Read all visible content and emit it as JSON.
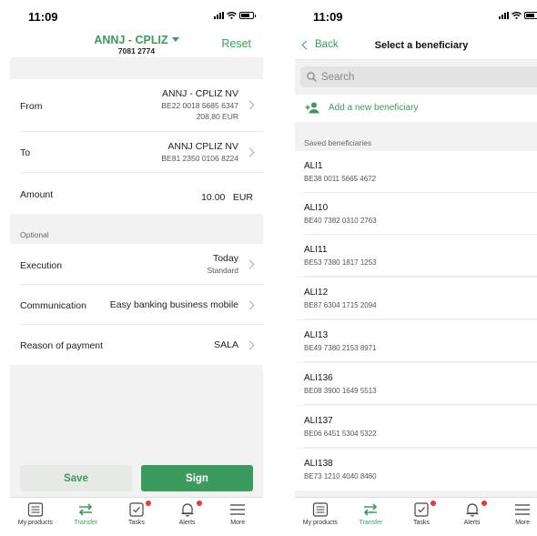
{
  "status": {
    "time": "11:09"
  },
  "transfer": {
    "account_title": "ANNJ - CPLIZ",
    "account_number": "7081 2774",
    "reset_label": "Reset",
    "from": {
      "label": "From",
      "name": "ANNJ - CPLIZ NV",
      "iban": "BE22 0018 5685 6347",
      "balance": "208,80 EUR"
    },
    "to": {
      "label": "To",
      "name": "ANNJ CPLIZ NV",
      "iban": "BE81 2350 0106 8224"
    },
    "amount": {
      "label": "Amount",
      "value": "10.00",
      "currency": "EUR"
    },
    "optional_label": "Optional",
    "execution": {
      "label": "Execution",
      "value": "Today",
      "sub": "Standard"
    },
    "communication": {
      "label": "Communication",
      "value": "Easy banking business mobile"
    },
    "reason": {
      "label": "Reason of payment",
      "value": "SALA"
    },
    "save_label": "Save",
    "sign_label": "Sign"
  },
  "beneficiary": {
    "back_label": "Back",
    "title": "Select a beneficiary",
    "search_placeholder": "Search",
    "add_label": "Add a new beneficiary",
    "saved_label": "Saved beneficiaries",
    "items": [
      {
        "name": "ALI1",
        "iban": "BE38 0011 5665 4672"
      },
      {
        "name": "ALI10",
        "iban": "BE40 7382 0310 2763"
      },
      {
        "name": "ALI11",
        "iban": "BE53 7380 1817 1253"
      },
      {
        "name": "ALI12",
        "iban": "BE87 6304 1715 2094"
      },
      {
        "name": "ALI13",
        "iban": "BE49 7380 2153 8971"
      },
      {
        "name": "ALI136",
        "iban": "BE08 3900 1649 5513"
      },
      {
        "name": "ALI137",
        "iban": "BE06 6451 5304 5322"
      },
      {
        "name": "ALI138",
        "iban": "BE73 1210 4040 8460"
      }
    ]
  },
  "tabs": [
    {
      "label": "My products",
      "icon": "products-icon"
    },
    {
      "label": "Transfer",
      "icon": "transfer-icon"
    },
    {
      "label": "Tasks",
      "icon": "tasks-icon"
    },
    {
      "label": "Alerts",
      "icon": "bell-icon"
    },
    {
      "label": "More",
      "icon": "menu-icon"
    }
  ],
  "colors": {
    "accent": "#3c9a5f",
    "badge": "#e53935",
    "background": "#f2f2f2"
  }
}
